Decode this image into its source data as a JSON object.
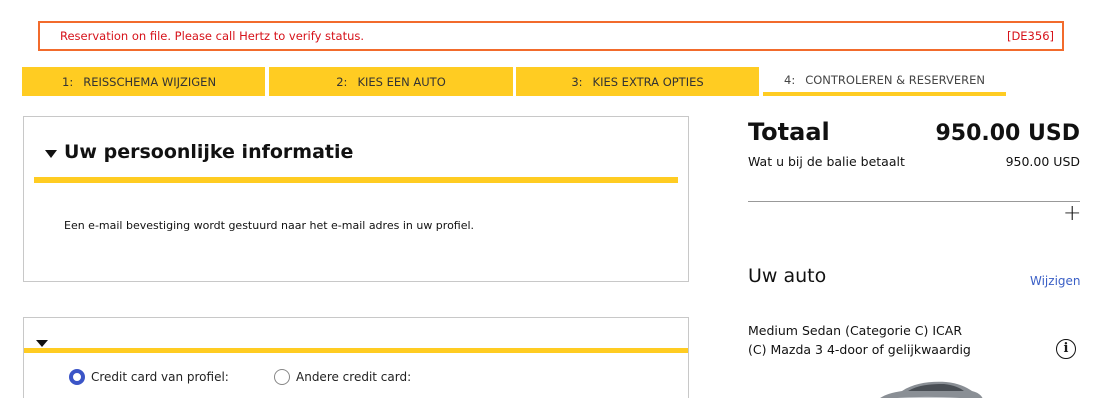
{
  "alert": {
    "message": "Reservation on file. Please call Hertz to verify status.",
    "code": "[DE356]"
  },
  "steps": [
    {
      "num": "1:",
      "label": "REISSCHEMA WIJZIGEN"
    },
    {
      "num": "2:",
      "label": "KIES EEN AUTO"
    },
    {
      "num": "3:",
      "label": "KIES EXTRA OPTIES"
    },
    {
      "num": "4:",
      "label": "CONTROLEREN & RESERVEREN"
    }
  ],
  "personal_info": {
    "title": "Uw persoonlijke informatie",
    "text": "Een e-mail bevestiging wordt gestuurd naar het e-mail adres in uw profiel."
  },
  "payment": {
    "options": [
      {
        "label": "Credit card van profiel:",
        "checked": true
      },
      {
        "label": "Andere credit card:",
        "checked": false
      }
    ]
  },
  "summary": {
    "total_label": "Totaal",
    "total_value": "950.00 USD",
    "balie_label": "Wat u bij de balie betaalt",
    "balie_value": "950.00 USD",
    "expand_symbol": "+"
  },
  "car": {
    "title": "Uw auto",
    "change_link": "Wijzigen",
    "description_line1": "Medium Sedan (Categorie C) ICAR",
    "description_line2": "(C) Mazda 3 4-door of gelijkwaardig",
    "info_symbol": "i"
  },
  "colors": {
    "accent_yellow": "#ffcc22",
    "alert_border": "#f26b2c",
    "alert_text": "#d6121a",
    "link_blue": "#3a5fc6"
  }
}
